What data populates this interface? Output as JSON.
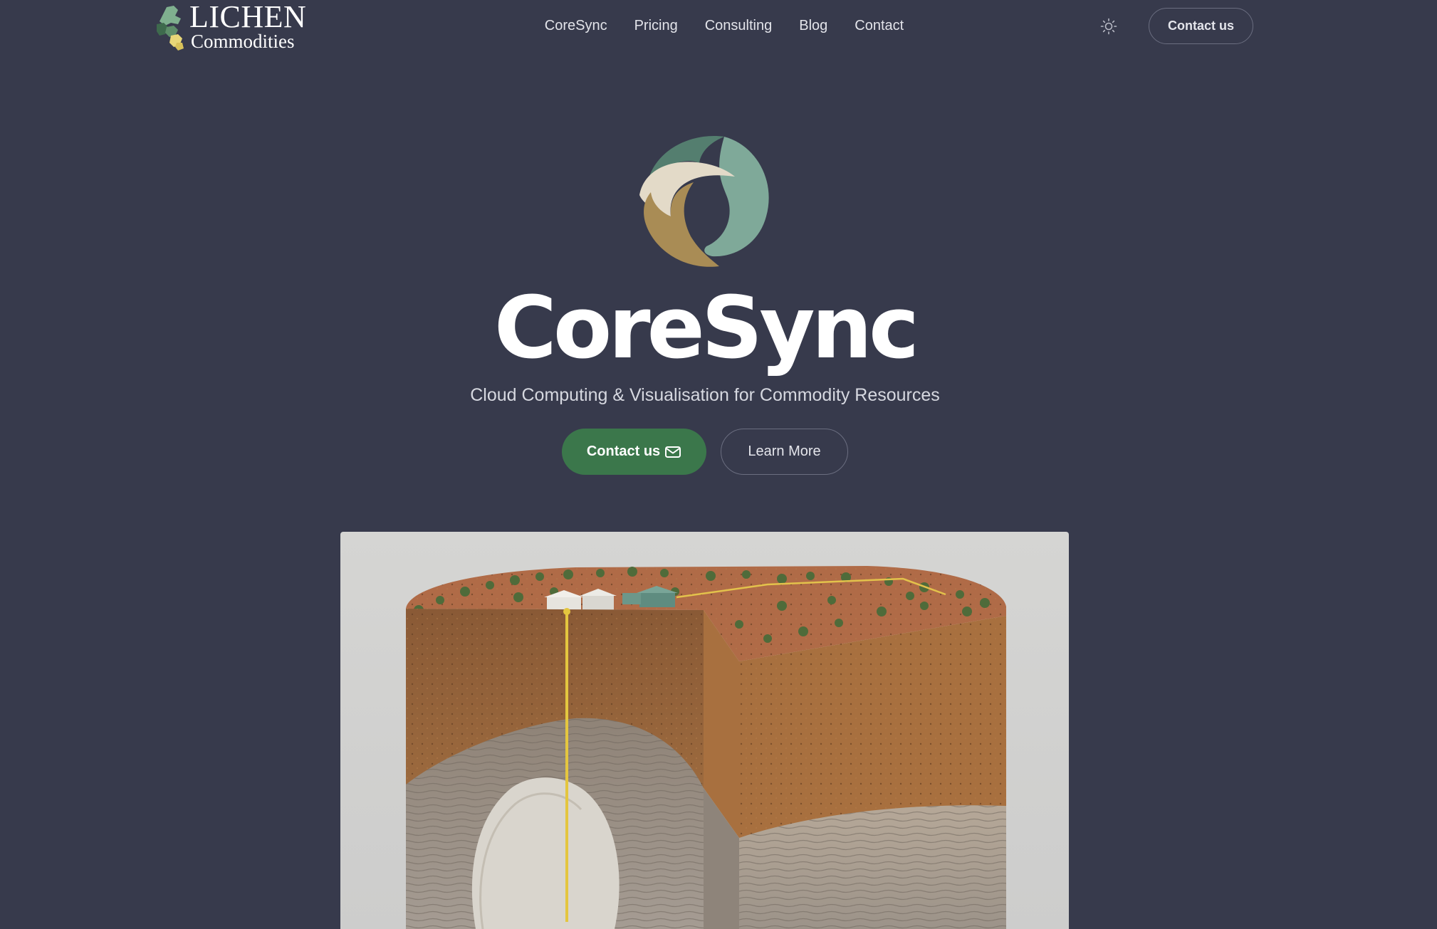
{
  "header": {
    "brand": {
      "line1": "LICHEN",
      "line2": "Commodities",
      "logo_icon": "lichen-mark-icon"
    },
    "nav": [
      {
        "label": "CoreSync"
      },
      {
        "label": "Pricing"
      },
      {
        "label": "Consulting"
      },
      {
        "label": "Blog"
      },
      {
        "label": "Contact"
      }
    ],
    "theme_toggle_icon": "sun-icon",
    "cta_label": "Contact us"
  },
  "hero": {
    "logo_icon": "coresync-swirl-icon",
    "title": "CoreSync",
    "subtitle": "Cloud Computing & Visualisation for Commodity Resources",
    "primary_button": {
      "label": "Contact us",
      "icon": "mail-icon"
    },
    "secondary_button": {
      "label": "Learn More"
    },
    "image": {
      "subject": "geological-cross-section-illustration"
    }
  },
  "colors": {
    "background": "#373a4c",
    "primary_button": "#3b774b",
    "logo_dark_green": "#547e6f",
    "logo_light_green": "#7fa999",
    "logo_cream": "#e3dac8",
    "logo_gold": "#a98c55",
    "text": "#ffffff"
  }
}
